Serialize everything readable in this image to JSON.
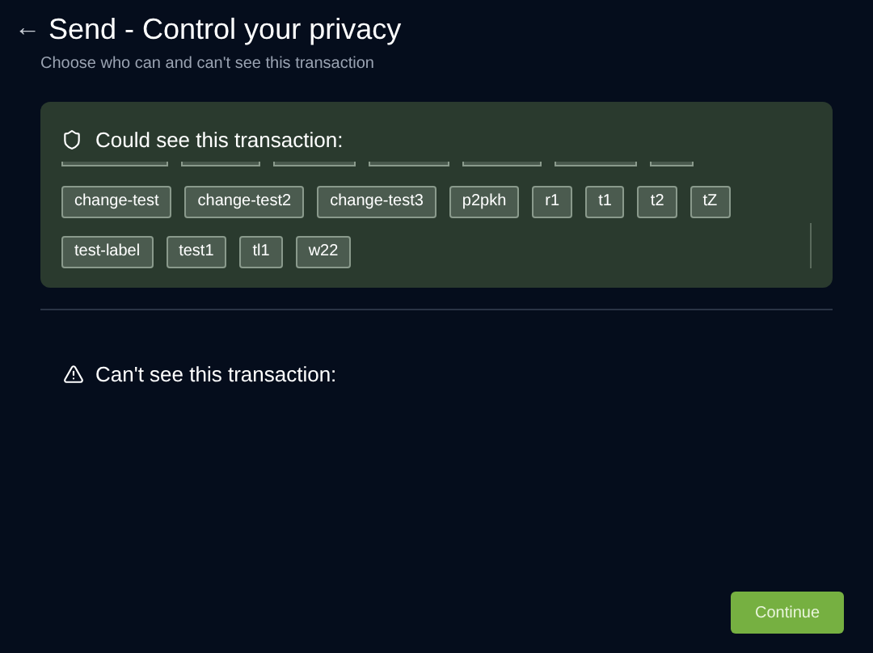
{
  "header": {
    "back": "←",
    "title": "Send - Control your privacy",
    "subtitle": "Choose who can and can't see this transaction"
  },
  "could_see": {
    "heading": "Could see this transaction:",
    "tags": [
      "change-test",
      "change-test2",
      "change-test3",
      "p2pkh",
      "r1",
      "t1",
      "t2",
      "tZ",
      "test-label",
      "test1",
      "tl1",
      "w22"
    ]
  },
  "cant_see": {
    "heading": "Can't see this transaction:"
  },
  "continue_button": "Continue"
}
